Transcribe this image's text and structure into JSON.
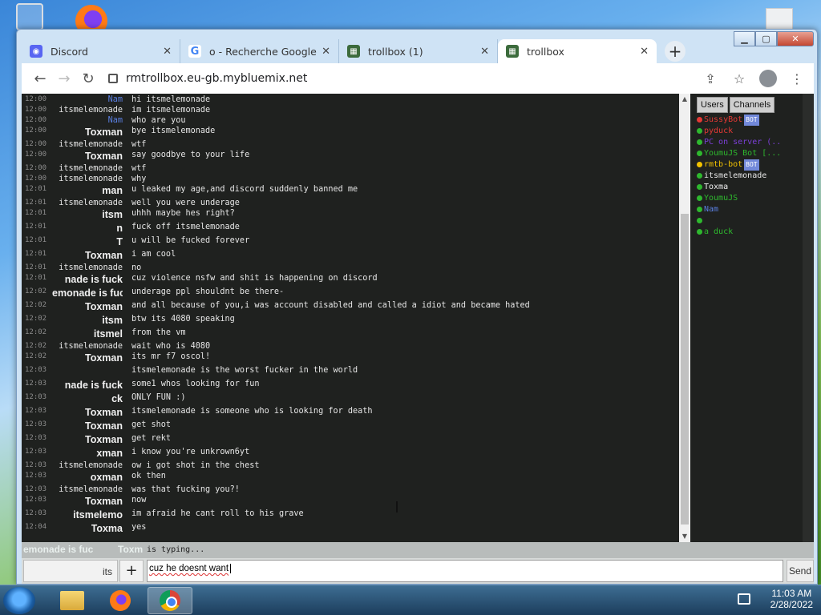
{
  "browser": {
    "tabs": [
      {
        "label": "Discord",
        "icon": "discord-icon",
        "color": "#5865f2"
      },
      {
        "label": "o - Recherche Google",
        "icon": "google-icon",
        "color": "#4285f4"
      },
      {
        "label": "trollbox (1)",
        "icon": "trollbox-icon",
        "color": "#3c6b3c"
      },
      {
        "label": "trollbox",
        "icon": "trollbox-icon",
        "color": "#3c6b3c"
      }
    ],
    "url": "rmtrollbox.eu-gb.mybluemix.net"
  },
  "chat": {
    "messages": [
      {
        "time": "12:00",
        "nick": "Nam",
        "style": "blue",
        "text": "hi itsmelemonade"
      },
      {
        "time": "12:00",
        "nick": "itsmelemonade",
        "style": "white",
        "text": "im itsmelemonade"
      },
      {
        "time": "12:00",
        "nick": "Nam",
        "style": "blue",
        "text": "who are you"
      },
      {
        "time": "12:00",
        "nick": "Toxman",
        "style": "big",
        "text": "bye itsmelemonade"
      },
      {
        "time": "12:00",
        "nick": "itsmelemonade",
        "style": "white",
        "text": "wtf"
      },
      {
        "time": "12:00",
        "nick": "Toxman",
        "style": "big",
        "text": "say goodbye to your life"
      },
      {
        "time": "12:00",
        "nick": "itsmelemonade",
        "style": "white",
        "text": "wtf"
      },
      {
        "time": "12:00",
        "nick": "itsmelemonade",
        "style": "white",
        "text": "why"
      },
      {
        "time": "12:01",
        "nick": "man",
        "style": "big",
        "text": "u leaked my age,and discord suddenly banned me"
      },
      {
        "time": "12:01",
        "nick": "itsmelemonade",
        "style": "white",
        "text": "well you were underage"
      },
      {
        "time": "12:01",
        "nick": "itsm",
        "style": "big",
        "text": "uhhh maybe hes right?"
      },
      {
        "time": "12:01",
        "nick": "n",
        "style": "big",
        "text": "fuck off itsmelemonade"
      },
      {
        "time": "12:01",
        "nick": "T",
        "style": "big",
        "text": "u will be fucked forever"
      },
      {
        "time": "12:01",
        "nick": "Toxman",
        "style": "big",
        "text": "i am cool"
      },
      {
        "time": "12:01",
        "nick": "itsmelemonade",
        "style": "white",
        "text": "no"
      },
      {
        "time": "12:01",
        "nick": "nade is fuck",
        "style": "big",
        "text": "cuz violence nsfw and shit is happening on discord"
      },
      {
        "time": "12:02",
        "nick": "emonade is fuc",
        "style": "big",
        "text": "underage ppl shouldnt be there-"
      },
      {
        "time": "12:02",
        "nick": "Toxman",
        "style": "big",
        "text": "and all because of you,i was account disabled and called a idiot and became hated"
      },
      {
        "time": "12:02",
        "nick": "itsm",
        "style": "big",
        "text": "btw its 4080 speaking"
      },
      {
        "time": "12:02",
        "nick": "itsmel",
        "style": "big",
        "text": "from the vm"
      },
      {
        "time": "12:02",
        "nick": "itsmelemonade",
        "style": "white",
        "text": "wait who is 4080"
      },
      {
        "time": "12:02",
        "nick": "Toxman",
        "style": "big",
        "text": "its mr f7 oscol!"
      },
      {
        "time": "12:03",
        "nick": "",
        "style": "white",
        "text": "itsmelemonade is the worst fucker in the world"
      },
      {
        "time": "12:03",
        "nick": "nade is fuck",
        "style": "big",
        "text": "some1 whos looking for fun"
      },
      {
        "time": "12:03",
        "nick": "ck",
        "style": "big",
        "text": "ONLY FUN :)"
      },
      {
        "time": "12:03",
        "nick": "Toxman",
        "style": "big",
        "text": "itsmelemonade is someone who is looking for death"
      },
      {
        "time": "12:03",
        "nick": "Toxman",
        "style": "big",
        "text": "get shot"
      },
      {
        "time": "12:03",
        "nick": "Toxman",
        "style": "big",
        "text": "get rekt"
      },
      {
        "time": "12:03",
        "nick": "xman",
        "style": "big",
        "text": "i know you're unkrown6yt"
      },
      {
        "time": "12:03",
        "nick": "itsmelemonade",
        "style": "white",
        "text": "ow i got shot in the chest"
      },
      {
        "time": "12:03",
        "nick": "oxman",
        "style": "big",
        "text": "ok then"
      },
      {
        "time": "12:03",
        "nick": "itsmelemonade",
        "style": "white",
        "text": "was that fucking you?!"
      },
      {
        "time": "12:03",
        "nick": "Toxman",
        "style": "big",
        "text": "now"
      },
      {
        "time": "12:03",
        "nick": "itsmelemo",
        "style": "big",
        "text": "im afraid he cant roll to his grave"
      },
      {
        "time": "12:04",
        "nick": "Toxma",
        "style": "big",
        "text": "yes"
      }
    ]
  },
  "sidebar": {
    "tabs": [
      "Users",
      "Channels"
    ],
    "users": [
      {
        "name": "SussyBot",
        "color": "#e53935",
        "dot": "#e53935",
        "bot": true
      },
      {
        "name": "pyduck",
        "color": "#e53935",
        "dot": "#2eb82e",
        "bot": false
      },
      {
        "name": "PC on server (...",
        "color": "#7b3fd6",
        "dot": "#2eb82e",
        "bot": false
      },
      {
        "name": "YoumuJS Bot [...",
        "color": "#2eb82e",
        "dot": "#2eb82e",
        "bot": true
      },
      {
        "name": "rmtb-bot",
        "color": "#f2c200",
        "dot": "#f2c200",
        "bot": true
      },
      {
        "name": "itsmelemonade",
        "color": "#e6e6e6",
        "dot": "#2eb82e",
        "bot": false
      },
      {
        "name": "Toxma",
        "color": "#f0f0f0",
        "dot": "#2eb82e",
        "bot": false
      },
      {
        "name": "YoumuJS",
        "color": "#2eb82e",
        "dot": "#2eb82e",
        "bot": false
      },
      {
        "name": "Nam",
        "color": "#5a7fe0",
        "dot": "#2eb82e",
        "bot": false
      },
      {
        "name": "",
        "color": "#e6e6e6",
        "dot": "#2eb82e",
        "bot": false
      },
      {
        "name": "a duck",
        "color": "#2eb82e",
        "dot": "#2eb82e",
        "bot": false
      }
    ],
    "bot_label": "BOT"
  },
  "typing": {
    "name1": "emonade is fuc",
    "name2": "Toxm",
    "label": "is typing..."
  },
  "composer": {
    "left_label": "its",
    "plus": "+",
    "value": "cuz he doesnt want",
    "send": "Send"
  },
  "taskbar": {
    "time": "11:03 AM",
    "date": "2/28/2022"
  }
}
